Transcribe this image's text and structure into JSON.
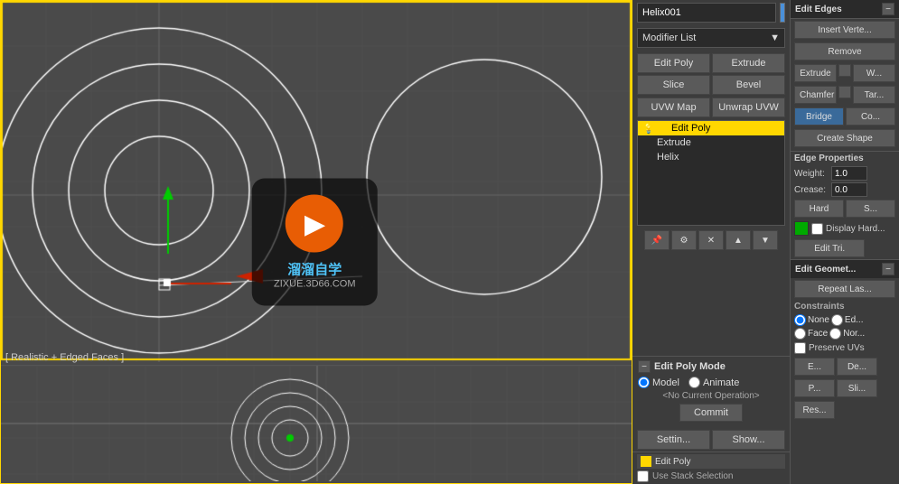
{
  "viewport": {
    "label": "[ Realistic + Edged Faces ]"
  },
  "object_header": {
    "name": "Helix001",
    "color": "#4a90d9"
  },
  "modifier": {
    "label": "Modifier List",
    "dropdown_arrow": "▼"
  },
  "buttons": {
    "edit_poly": "Edit Poly",
    "extrude": "Extrude",
    "slice": "Slice",
    "bevel": "Bevel",
    "uvw_map": "UVW Map",
    "unwrap_uvw": "Unwrap UVW"
  },
  "stack": {
    "items": [
      {
        "label": "Edit Poly",
        "active": true,
        "has_icon": true
      },
      {
        "label": "Extrude",
        "active": false,
        "has_icon": false
      },
      {
        "label": "Helix",
        "active": false,
        "has_icon": false
      }
    ]
  },
  "stack_controls": {
    "buttons": [
      "📌",
      "🔧",
      "🗑",
      "▲",
      "▼"
    ]
  },
  "edit_edges": {
    "title": "Edit Edges",
    "insert_vertex": "Insert Verte...",
    "remove": "Remove",
    "extrude": "Extrude",
    "weld": "W...",
    "chamfer": "Chamfer",
    "target": "Tar...",
    "bridge": "Bridge",
    "connect": "Co...",
    "create_shape": "Create Shape",
    "edge_properties": "Edge Properties",
    "weight_label": "Weight:",
    "weight_value": "1.0",
    "crease_label": "Crease:",
    "crease_value": "0.0",
    "hard": "Hard",
    "smooth": "S...",
    "display_hard": "Display Hard...",
    "edit_tri": "Edit Tri."
  },
  "edit_geo": {
    "title": "Edit Geomet...",
    "repeat_last": "Repeat Las..."
  },
  "constraints": {
    "title": "Constraints",
    "none": "None",
    "edge": "Ed...",
    "face": "Face",
    "normal": "Nor..."
  },
  "preserve": {
    "label": "Preserve UVs"
  },
  "edit_poly_mode": {
    "title": "Edit Poly Mode",
    "model": "Model",
    "animate": "Animate",
    "no_op": "<No Current Operation>",
    "commit": "Commit"
  },
  "settings": {
    "show": "Show...",
    "settings_btn": "Settin..."
  },
  "bottom_panel": {
    "use_stack": "Use Stack Selection"
  },
  "icons": {
    "minus": "−",
    "plus": "+",
    "pin": "📌",
    "config": "⚙",
    "delete": "✕",
    "up": "▲",
    "down": "▼",
    "arrow_down": "▼"
  },
  "colors": {
    "active_yellow": "#ffd700",
    "panel_bg": "#3c3c3c",
    "dark_bg": "#2a2a2a",
    "btn_bg": "#5a5a5a",
    "border": "#555555",
    "green": "#00aa00",
    "blue_accent": "#3a6a9a"
  }
}
